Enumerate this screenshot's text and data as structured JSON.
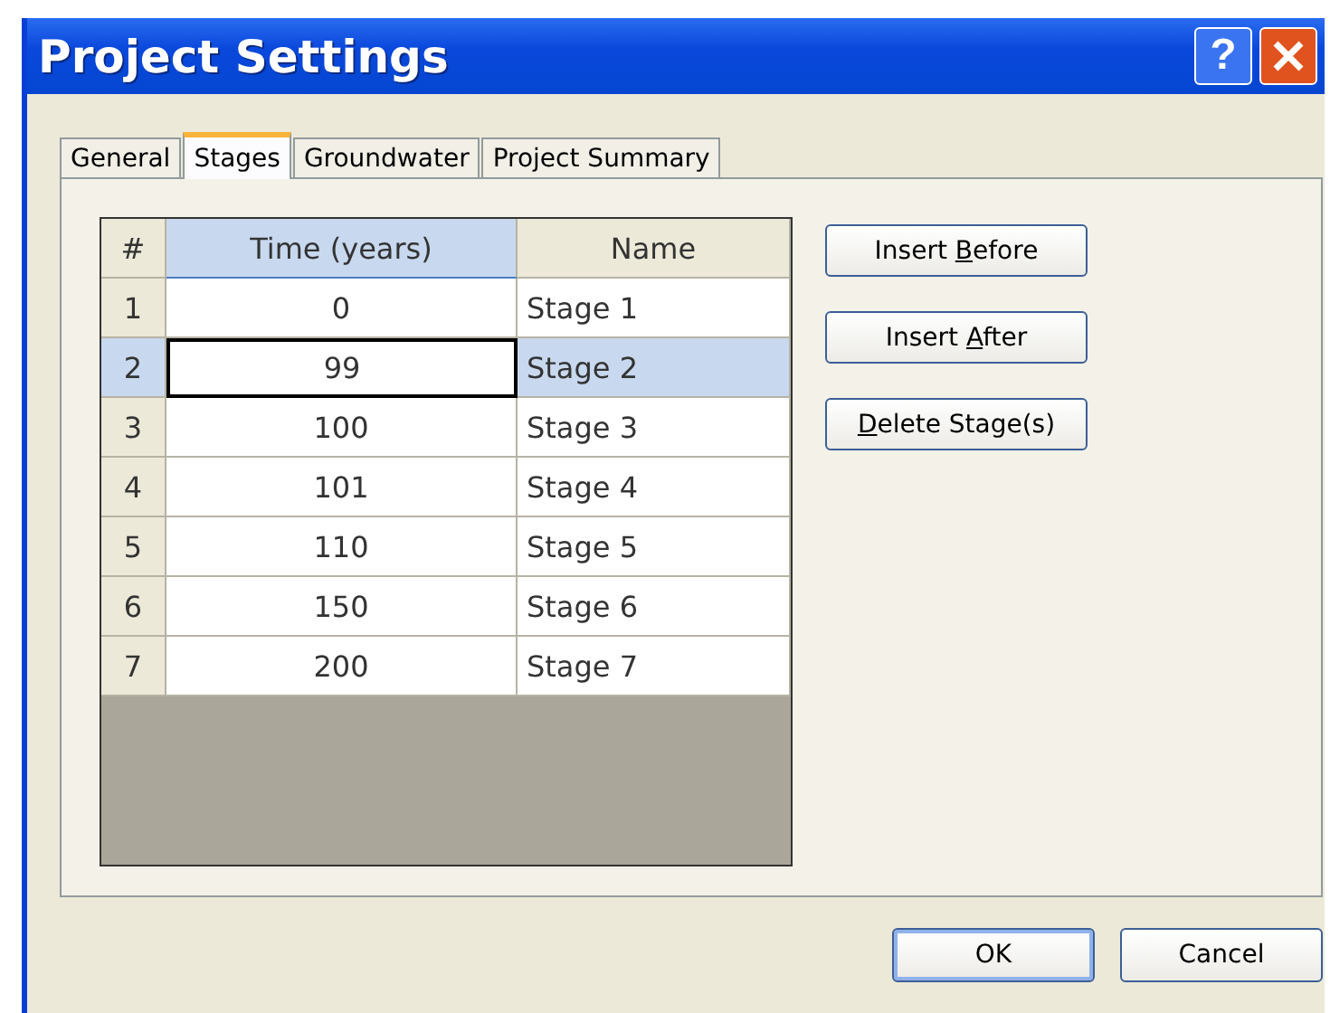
{
  "window": {
    "title": "Project Settings",
    "title_buttons": [
      {
        "kind": "help",
        "label": "?"
      },
      {
        "kind": "close"
      }
    ]
  },
  "tabs": [
    {
      "label": "General",
      "selected": false
    },
    {
      "label": "Stages",
      "selected": true
    },
    {
      "label": "Groundwater",
      "selected": false
    },
    {
      "label": "Project Summary",
      "selected": false
    }
  ],
  "table": {
    "columns": [
      {
        "label": "#",
        "selected": false
      },
      {
        "label": "Time (years)",
        "selected": true
      },
      {
        "label": "Name",
        "selected": false
      }
    ],
    "rows": [
      {
        "cells": [
          "1",
          "0",
          "Stage 1"
        ],
        "selected": false
      },
      {
        "cells": [
          "2",
          "99",
          "Stage 2"
        ],
        "selected": true
      },
      {
        "cells": [
          "3",
          "100",
          "Stage 3"
        ],
        "selected": false
      },
      {
        "cells": [
          "4",
          "101",
          "Stage 4"
        ],
        "selected": false
      },
      {
        "cells": [
          "5",
          "110",
          "Stage 5"
        ],
        "selected": false
      },
      {
        "cells": [
          "6",
          "150",
          "Stage 6"
        ],
        "selected": false
      },
      {
        "cells": [
          "7",
          "200",
          "Stage 7"
        ],
        "selected": false
      }
    ]
  },
  "side_buttons": [
    {
      "before": "Insert ",
      "key": "B",
      "after": "efore"
    },
    {
      "before": "Insert ",
      "key": "A",
      "after": "fter"
    },
    {
      "key": "D",
      "after": "elete Stage(s)"
    }
  ],
  "buttons": [
    {
      "label": "OK",
      "default": true
    },
    {
      "label": "Cancel",
      "default": false
    }
  ]
}
